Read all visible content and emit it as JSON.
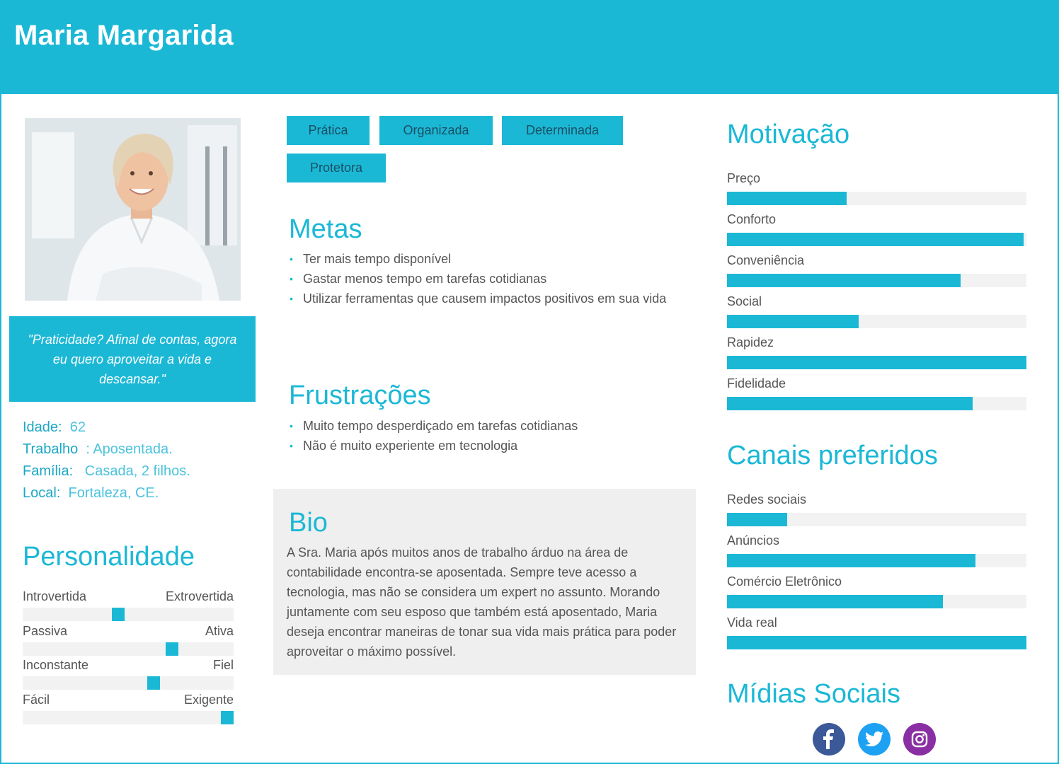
{
  "header": {
    "name": "Maria Margarida"
  },
  "profile": {
    "quote": "\"Praticidade? Afinal de contas, agora eu quero aproveitar a vida e descansar.\"",
    "facts": [
      {
        "label": "Idade:",
        "value": "62"
      },
      {
        "label": "Trabalho",
        "value": ": Aposentada."
      },
      {
        "label": "Família:",
        "value": "Casada, 2 filhos."
      },
      {
        "label": "Local:",
        "value": "Fortaleza, CE."
      }
    ]
  },
  "personality": {
    "title": "Personalidade",
    "traits": [
      {
        "left": "Introvertida",
        "right": "Extrovertida",
        "level": 0.45
      },
      {
        "left": "Passiva",
        "right": "Ativa",
        "level": 0.72
      },
      {
        "left": "Inconstante",
        "right": "Fiel",
        "level": 0.63
      },
      {
        "left": "Fácil",
        "right": "Exigente",
        "level": 1.0
      }
    ]
  },
  "tags": [
    "Prática",
    "Organizada",
    "Determinada",
    "Protetora"
  ],
  "goals": {
    "title": "Metas",
    "items": [
      "Ter mais tempo disponível",
      "Gastar menos tempo em tarefas cotidianas",
      "Utilizar ferramentas que causem impactos positivos em sua vida"
    ]
  },
  "frustrations": {
    "title": "Frustrações",
    "items": [
      "Muito tempo desperdiçado em tarefas cotidianas",
      "Não é muito experiente em tecnologia"
    ]
  },
  "bio": {
    "title": "Bio",
    "text": "A Sra. Maria após muitos anos de trabalho árduo na área de contabilidade encontra-se aposentada. Sempre teve acesso a tecnologia, mas não se considera um expert no assunto. Morando juntamente com seu esposo que também está aposentado, Maria deseja encontrar maneiras de tonar sua vida mais prática para poder aproveitar o máximo possível."
  },
  "motivation": {
    "title": "Motivação",
    "items": [
      {
        "label": "Preço",
        "level": 0.4
      },
      {
        "label": "Conforto",
        "level": 0.99
      },
      {
        "label": "Conveniência",
        "level": 0.78
      },
      {
        "label": "Social",
        "level": 0.44
      },
      {
        "label": "Rapidez",
        "level": 1.0
      },
      {
        "label": "Fidelidade",
        "level": 0.82
      }
    ]
  },
  "channels": {
    "title": "Canais preferidos",
    "items": [
      {
        "label": "Redes sociais",
        "level": 0.2
      },
      {
        "label": "Anúncios",
        "level": 0.83
      },
      {
        "label": "Comércio Eletrônico",
        "level": 0.72
      },
      {
        "label": "Vida real",
        "level": 1.0
      }
    ]
  },
  "social_media": {
    "title": "Mídias Sociais",
    "icons": [
      {
        "name": "facebook-icon",
        "color": "#3b5998"
      },
      {
        "name": "twitter-icon",
        "color": "#1da1f2"
      },
      {
        "name": "instagram-icon",
        "color": "#8a2fa3"
      }
    ]
  },
  "colors": {
    "accent": "#1bb8d6"
  }
}
